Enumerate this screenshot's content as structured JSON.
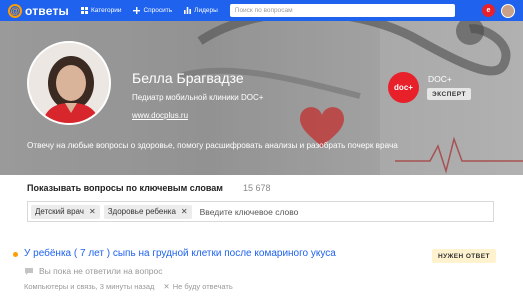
{
  "navbar": {
    "logo_text": "ответы",
    "items": [
      {
        "label": "Категории",
        "icon": "grid-icon"
      },
      {
        "label": "Спросить",
        "icon": "plus-icon"
      },
      {
        "label": "Лидеры",
        "icon": "bar-chart-icon"
      }
    ],
    "search_placeholder": "Поиск по вопросам",
    "notification_label": "е"
  },
  "expert": {
    "name": "Белла Брагвадзе",
    "role": "Педиатр мобильной клиники DOC+",
    "link": "www.docplus.ru",
    "description": "Отвечу на любые вопросы о здоровье, помогу расшифровать анализы и разобрать почерк врача",
    "clinic_logo_text": "doc+",
    "clinic_name": "DOC+",
    "badge": "ЭКСПЕРТ"
  },
  "keywords": {
    "title": "Показывать вопросы по ключевым словам",
    "count": "15 678",
    "tags": [
      "Детский врач",
      "Здоровье ребенка"
    ],
    "input_placeholder": "Введите ключевое слово"
  },
  "question": {
    "title": "У ребёнка ( 7 лет ) сыпь на грудной клетки после комариного укуса",
    "badge": "НУЖЕН ОТВЕТ",
    "status": "Вы пока не ответили на вопрос",
    "meta": "Компьютеры и связь, 3 минуты назад",
    "skip_label": "Не буду отвечать"
  },
  "colors": {
    "navbar": "#1e62ee",
    "accent": "#ff9e00",
    "link": "#1e62ee",
    "clinic": "#e8202a"
  }
}
